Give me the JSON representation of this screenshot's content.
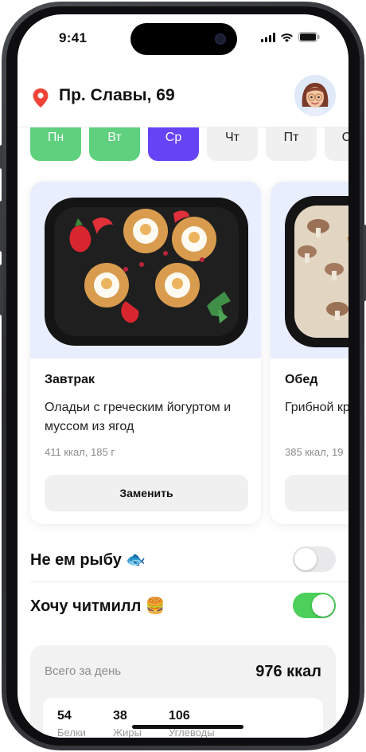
{
  "status_bar": {
    "time": "9:41"
  },
  "header": {
    "address": "Пр. Славы, 69"
  },
  "days": [
    {
      "label": "Пн",
      "state": "done"
    },
    {
      "label": "Вт",
      "state": "done"
    },
    {
      "label": "Ср",
      "state": "selected"
    },
    {
      "label": "Чт",
      "state": "upcoming"
    },
    {
      "label": "Пт",
      "state": "upcoming"
    },
    {
      "label": "Сб",
      "state": "upcoming"
    }
  ],
  "meals": [
    {
      "title": "Завтрак",
      "description": "Оладьи с греческим йогуртом и муссом из ягод",
      "meta": "411 ккал, 185 г",
      "button": "Заменить"
    },
    {
      "title": "Обед",
      "description": "Грибной крем-суп и крутонами",
      "meta": "385 ккал, 19",
      "button": ""
    }
  ],
  "toggles": {
    "no_fish": {
      "label": "Не ем рыбу 🐟",
      "on": false
    },
    "cheat_meal": {
      "label": "Хочу читмилл 🍔",
      "on": true
    }
  },
  "summary": {
    "label": "Всего за день",
    "value": "976 ккал",
    "macros": [
      {
        "value": "54",
        "label": "Белки"
      },
      {
        "value": "38",
        "label": "Жиры"
      },
      {
        "value": "106",
        "label": "Углеводы"
      }
    ]
  },
  "colors": {
    "done_day": "#5ed07e",
    "selected_day": "#6644f5",
    "toggle_on": "#4ccf5b",
    "card_photo_bg": "#e8eefd",
    "pin": "#f04438"
  },
  "icons": [
    "location-pin-icon",
    "signal-icon",
    "wifi-icon",
    "battery-icon",
    "avatar"
  ]
}
